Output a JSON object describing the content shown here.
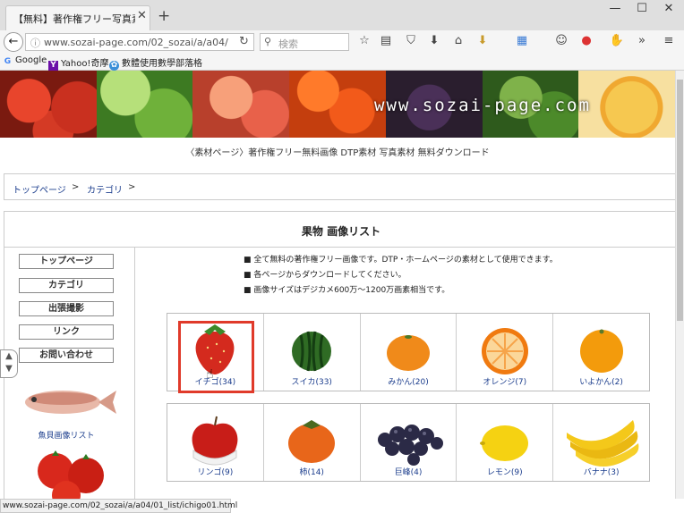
{
  "browser": {
    "tab_title": "【無料】著作権フリー写真素...",
    "tab_close": "✕",
    "new_tab": "+",
    "window_min": "—",
    "window_max": "☐",
    "window_close": "✕",
    "back": "←",
    "url": "www.sozai-page.com/02_sozai/a/a04/",
    "search_placeholder": "検索",
    "bookmarks": [
      "Google",
      "Yahoo!奇摩",
      "數體使用數學部落格"
    ],
    "status_url": "www.sozai-page.com/02_sozai/a/a04/01_list/ichigo01.html"
  },
  "site": {
    "banner_url": "www.sozai-page.com",
    "tagline": "〈素材ページ〉著作権フリー無料画像 DTP素材 写真素材 無料ダウンロード",
    "breadcrumb": [
      "トップページ",
      "カテゴリ"
    ],
    "breadcrumb_sep": ">",
    "page_title": "果物 画像リスト",
    "sidebar": [
      "トップページ",
      "カテゴリ",
      "出張撮影",
      "リンク",
      "お問い合わせ"
    ],
    "fish_label": "魚貝画像リスト",
    "notes": [
      "■ 全て無料の著作権フリー画像です。DTP・ホームページの素材として使用できます。",
      "■ 各ページからダウンロードしてください。",
      "■ 画像サイズはデジカメ600万～1200万画素相当です。"
    ],
    "fruits_row1": [
      "イチゴ(34)",
      "スイカ(33)",
      "みかん(20)",
      "オレンジ(7)",
      "いよかん(2)"
    ],
    "fruits_row2": [
      "リンゴ(9)",
      "柿(14)",
      "巨峰(4)",
      "レモン(9)",
      "バナナ(3)"
    ]
  },
  "colors": {
    "link": "#1a3c8c",
    "highlight": "#e03a2a"
  }
}
